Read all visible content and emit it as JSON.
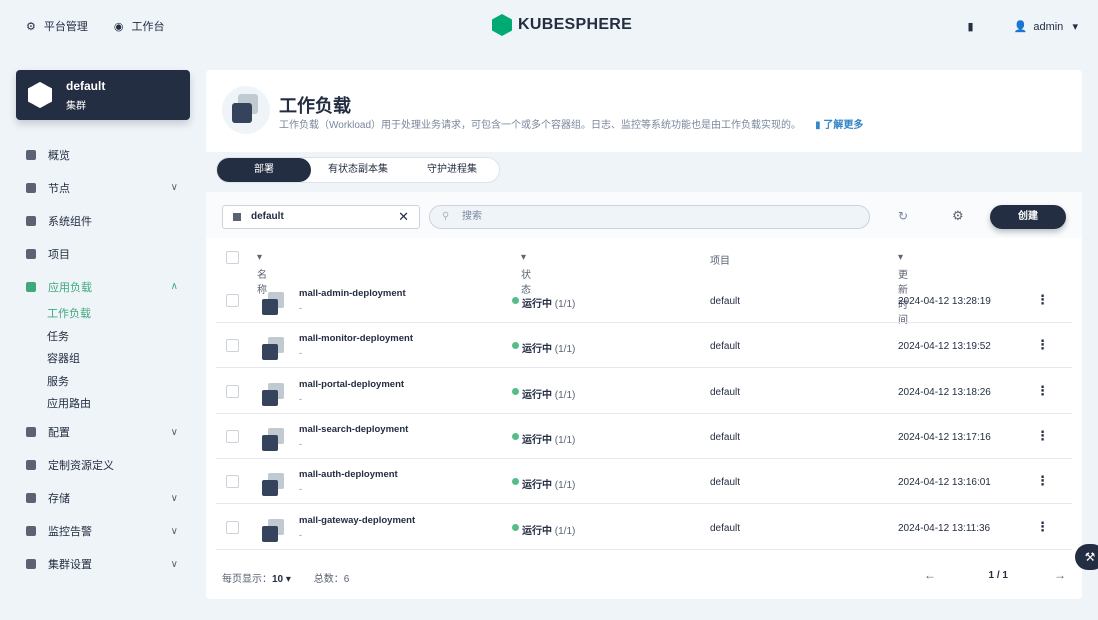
{
  "topbar": {
    "platform": "平台管理",
    "workbench": "工作台",
    "brand": "KUBESPHERE",
    "user": "admin"
  },
  "cluster": {
    "name": "default",
    "type": "集群"
  },
  "nav": {
    "overview": "概览",
    "nodes": "节点",
    "components": "系统组件",
    "projects": "项目",
    "workloads_group": "应用负载",
    "sub": [
      "工作负载",
      "任务",
      "容器组",
      "服务",
      "应用路由"
    ],
    "config": "配置",
    "crd": "定制资源定义",
    "storage": "存储",
    "monitoring": "监控告警",
    "settings": "集群设置"
  },
  "header": {
    "title": "工作负载",
    "desc": "工作负载（Workload）用于处理业务请求，可包含一个或多个容器组。日志、监控等系统功能也是由工作负载实现的。",
    "learn_more": "了解更多"
  },
  "tabs": [
    "部署",
    "有状态副本集",
    "守护进程集"
  ],
  "toolbar": {
    "namespace": "default",
    "search_placeholder": "搜索",
    "create": "创建"
  },
  "table": {
    "headers": {
      "name": "名称",
      "status": "状态",
      "project": "项目",
      "updated": "更新时间"
    },
    "rows": [
      {
        "name": "mall-admin-deployment",
        "desc": "-",
        "status": "运行中",
        "count": "(1/1)",
        "project": "default",
        "time": "2024-04-12 13:28:19"
      },
      {
        "name": "mall-monitor-deployment",
        "desc": "-",
        "status": "运行中",
        "count": "(1/1)",
        "project": "default",
        "time": "2024-04-12 13:19:52"
      },
      {
        "name": "mall-portal-deployment",
        "desc": "-",
        "status": "运行中",
        "count": "(1/1)",
        "project": "default",
        "time": "2024-04-12 13:18:26"
      },
      {
        "name": "mall-search-deployment",
        "desc": "-",
        "status": "运行中",
        "count": "(1/1)",
        "project": "default",
        "time": "2024-04-12 13:17:16"
      },
      {
        "name": "mall-auth-deployment",
        "desc": "-",
        "status": "运行中",
        "count": "(1/1)",
        "project": "default",
        "time": "2024-04-12 13:16:01"
      },
      {
        "name": "mall-gateway-deployment",
        "desc": "-",
        "status": "运行中",
        "count": "(1/1)",
        "project": "default",
        "time": "2024-04-12 13:11:36"
      }
    ]
  },
  "footer": {
    "per_page_label": "每页显示：",
    "per_page": "10",
    "total": "总数：6",
    "page": "1 / 1"
  }
}
